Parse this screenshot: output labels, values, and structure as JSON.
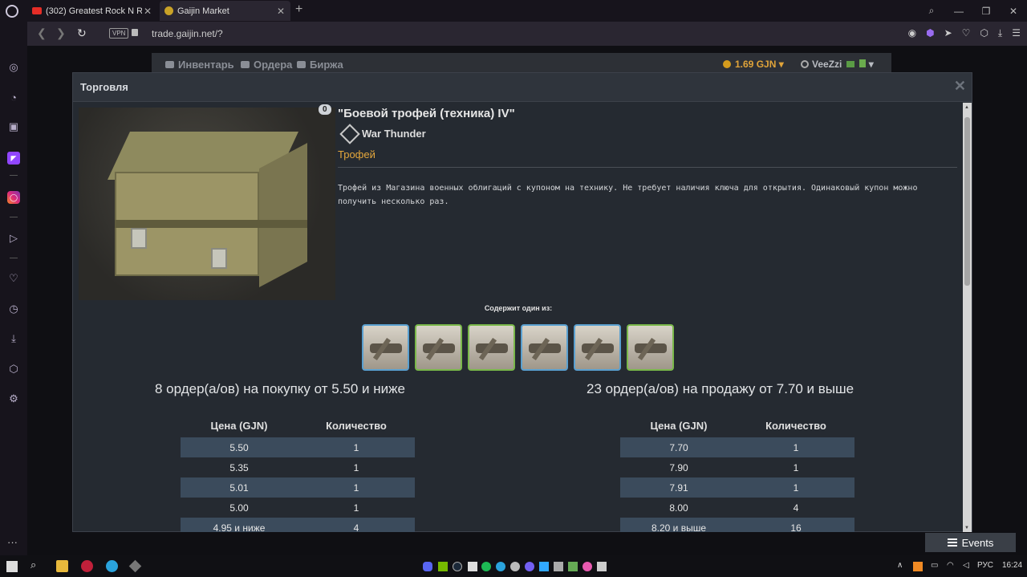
{
  "browser": {
    "tabs": [
      {
        "title": "(302) Greatest Rock N Roll",
        "active": false
      },
      {
        "title": "Gaijin Market",
        "active": true
      }
    ],
    "vpn_label": "VPN",
    "url": "trade.gaijin.net/?"
  },
  "site_nav": {
    "inventory": "Инвентарь",
    "orders": "Ордера",
    "exchange": "Биржа",
    "balance": "1.69 GJN",
    "username": "VeeZzi"
  },
  "modal": {
    "title": "Торговля",
    "item": {
      "count": "0",
      "name": "\"Боевой трофей (техника) IV\"",
      "game": "War Thunder",
      "type": "Трофей",
      "description": "Трофей из Магазина военных облигаций с купоном на технику. Не требует наличия ключа для открытия. Одинаковый купон можно получить несколько раз."
    },
    "contains_label": "Содержит один из:",
    "thumb_borders": [
      "blue",
      "green",
      "green",
      "blue",
      "blue",
      "green"
    ],
    "buy": {
      "title": "8 ордер(а/ов) на покупку от 5.50 и ниже",
      "headers": [
        "Цена (GJN)",
        "Количество"
      ],
      "rows": [
        [
          "5.50",
          "1"
        ],
        [
          "5.35",
          "1"
        ],
        [
          "5.01",
          "1"
        ],
        [
          "5.00",
          "1"
        ],
        [
          "4.95 и ниже",
          "4"
        ]
      ]
    },
    "sell": {
      "title": "23 ордер(а/ов) на продажу от 7.70 и выше",
      "headers": [
        "Цена (GJN)",
        "Количество"
      ],
      "rows": [
        [
          "7.70",
          "1"
        ],
        [
          "7.90",
          "1"
        ],
        [
          "7.91",
          "1"
        ],
        [
          "8.00",
          "4"
        ],
        [
          "8.20 и выше",
          "16"
        ]
      ]
    }
  },
  "events_label": "Events",
  "taskbar": {
    "lang": "РУС",
    "time": "16:24"
  }
}
